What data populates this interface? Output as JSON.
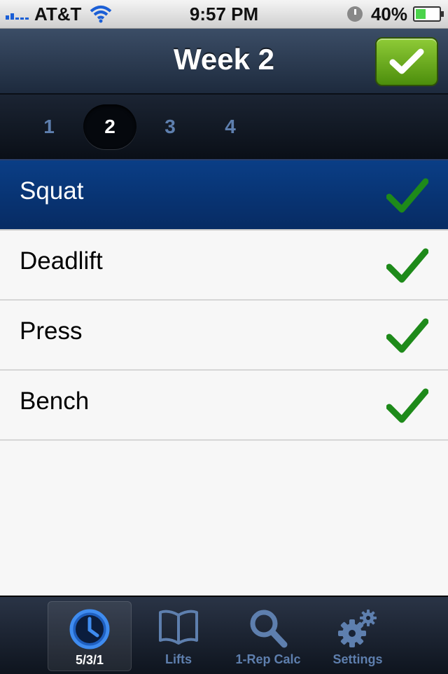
{
  "status_bar": {
    "carrier": "AT&T",
    "time": "9:57 PM",
    "battery_percent": "40%",
    "battery_level": 0.4
  },
  "nav": {
    "title": "Week 2",
    "done_icon": "checkmark-icon",
    "accent": "#6aa820"
  },
  "weeks": {
    "items": [
      "1",
      "2",
      "3",
      "4"
    ],
    "selected_index": 1
  },
  "lifts": [
    {
      "label": "Squat",
      "done": true,
      "selected": true
    },
    {
      "label": "Deadlift",
      "done": true,
      "selected": false
    },
    {
      "label": "Press",
      "done": true,
      "selected": false
    },
    {
      "label": "Bench",
      "done": true,
      "selected": false
    }
  ],
  "tabs": [
    {
      "label": "5/3/1",
      "icon": "clock-icon",
      "selected": true
    },
    {
      "label": "Lifts",
      "icon": "book-icon",
      "selected": false
    },
    {
      "label": "1-Rep Calc",
      "icon": "magnifier-icon",
      "selected": false
    },
    {
      "label": "Settings",
      "icon": "gears-icon",
      "selected": false
    }
  ],
  "colors": {
    "selected_row": "#0a3e86",
    "check_green": "#1e8a1a",
    "tab_inactive": "#5e7fae"
  }
}
